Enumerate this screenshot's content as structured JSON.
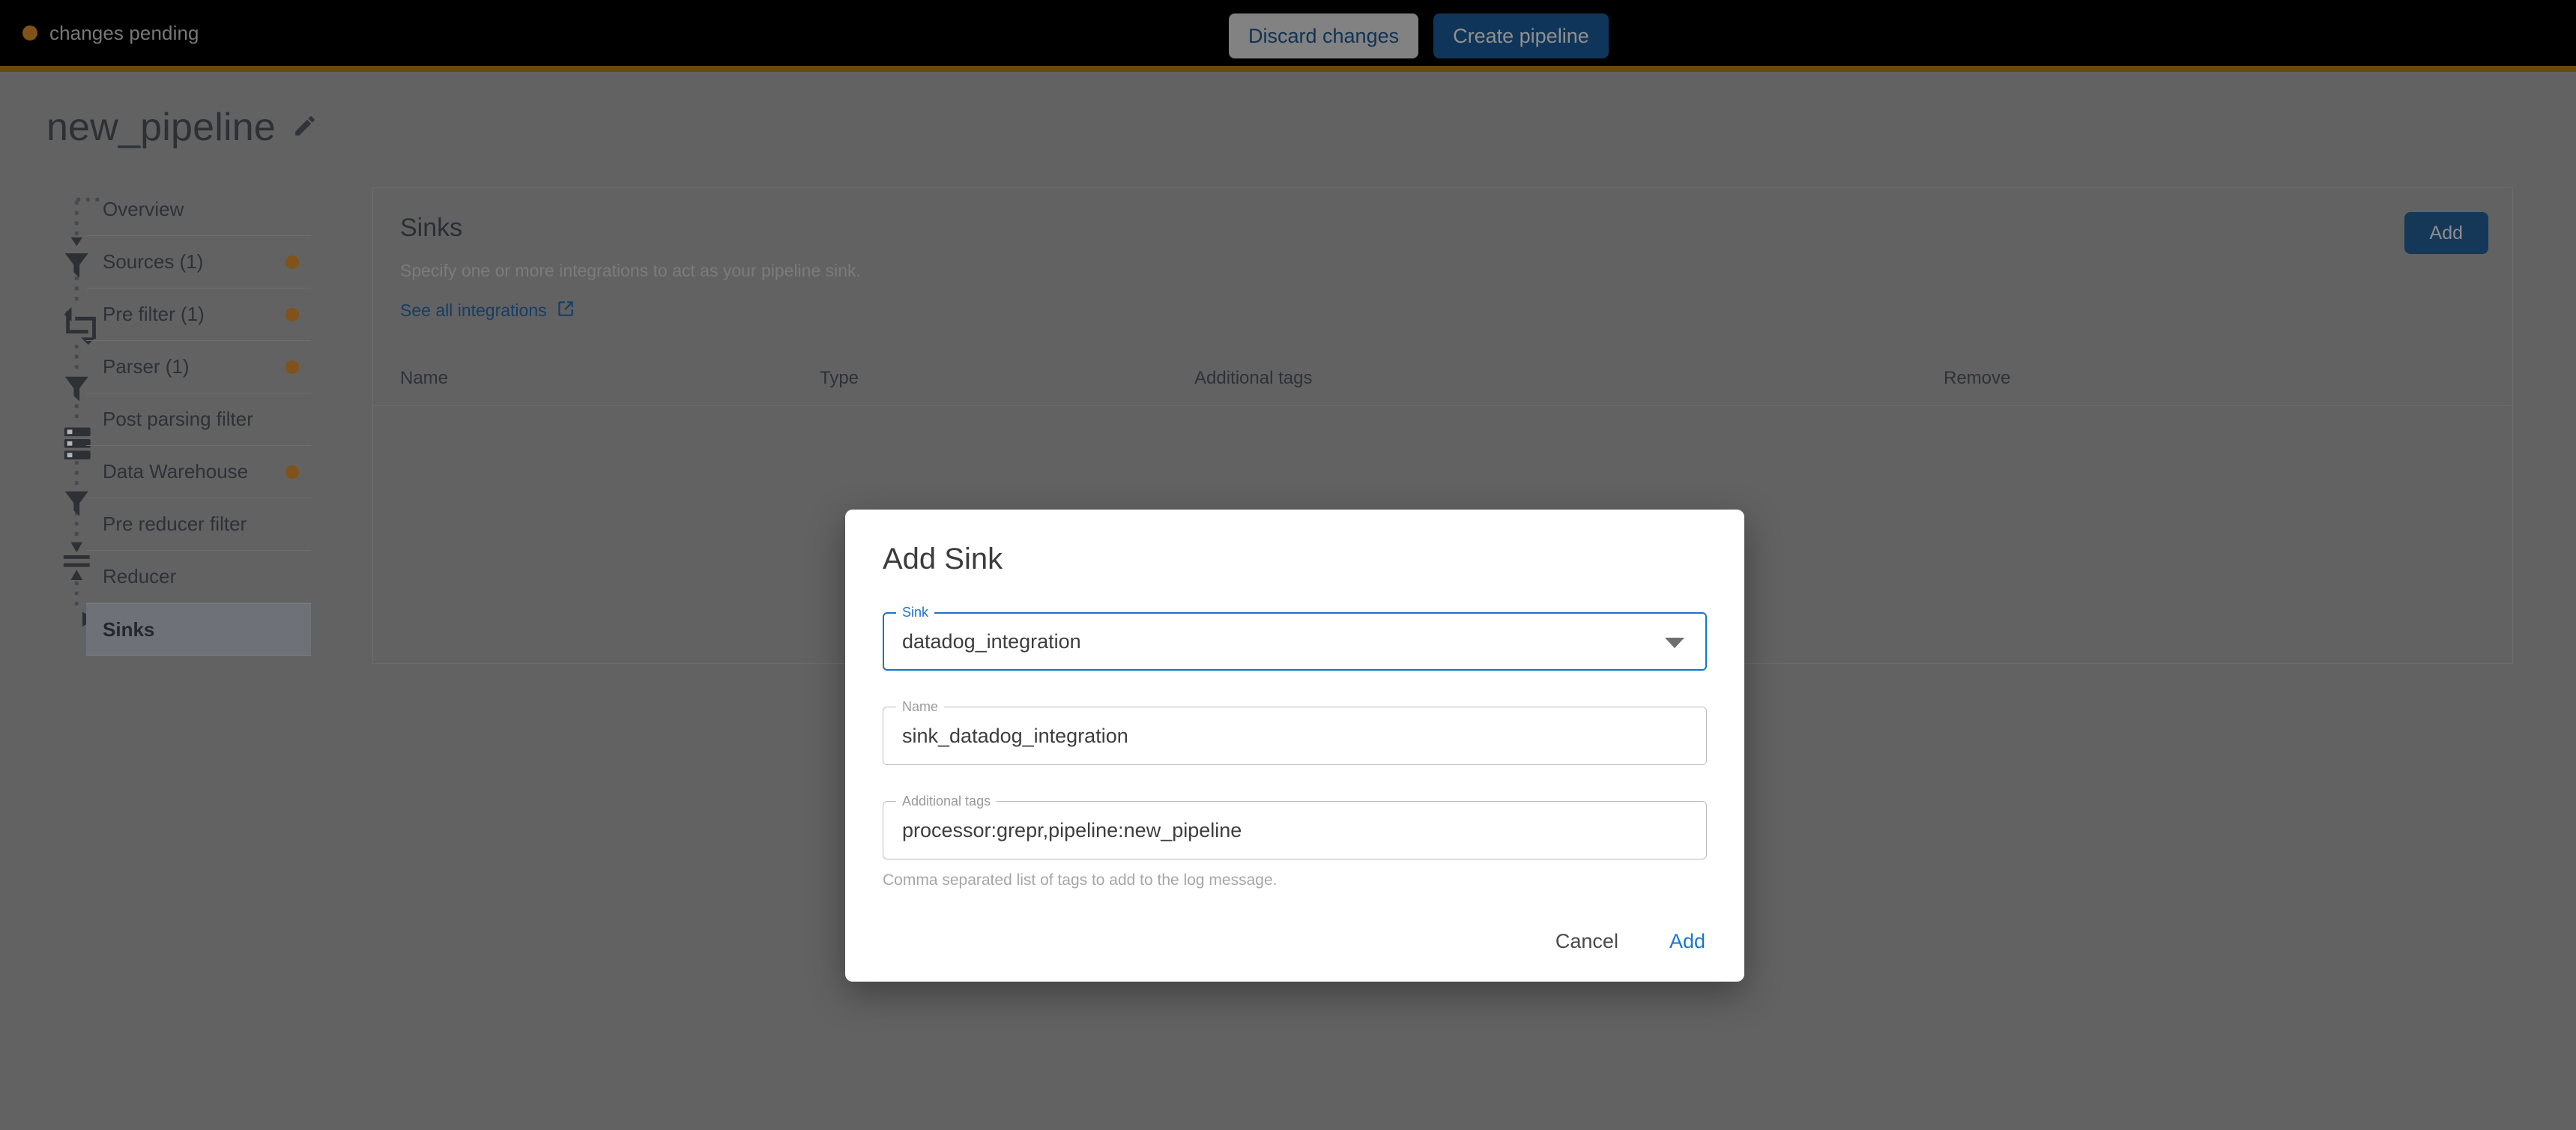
{
  "topbar": {
    "status_text": "changes pending",
    "status_dot_color": "#a66a20",
    "discard_label": "Discard changes",
    "create_label": "Create pipeline",
    "accent_border_color": "#8a5d16"
  },
  "header": {
    "pipeline_name": "new_pipeline",
    "edit_icon": "pencil-icon"
  },
  "sidebar": {
    "items": [
      {
        "label": "Overview",
        "icon": "",
        "dot": false,
        "selected": false
      },
      {
        "label": "Sources (1)",
        "icon": "flow-entry-icon",
        "dot": true,
        "selected": false
      },
      {
        "label": "Pre filter (1)",
        "icon": "filter-funnel-icon",
        "dot": true,
        "selected": false
      },
      {
        "label": "Parser (1)",
        "icon": "parser-crop-icon",
        "dot": true,
        "selected": false
      },
      {
        "label": "Post parsing filter",
        "icon": "filter-funnel-icon",
        "dot": false,
        "selected": false
      },
      {
        "label": "Data Warehouse",
        "icon": "database-icon",
        "dot": true,
        "selected": false
      },
      {
        "label": "Pre reducer filter",
        "icon": "filter-funnel-icon",
        "dot": false,
        "selected": false
      },
      {
        "label": "Reducer",
        "icon": "reducer-icon",
        "dot": false,
        "selected": false
      },
      {
        "label": "Sinks",
        "icon": "flow-exit-icon",
        "dot": false,
        "selected": true
      }
    ]
  },
  "main": {
    "title": "Sinks",
    "description": "Specify one or more integrations to act as your pipeline sink.",
    "link_label": "See all integrations",
    "link_icon": "external-link-icon",
    "add_button_label": "Add",
    "table": {
      "columns": [
        "Name",
        "Type",
        "Additional tags",
        "Remove"
      ],
      "rows": []
    }
  },
  "modal": {
    "title": "Add Sink",
    "fields": [
      {
        "label": "Sink",
        "value": "datadog_integration",
        "type": "select",
        "focused": true,
        "hint": ""
      },
      {
        "label": "Name",
        "value": "sink_datadog_integration",
        "type": "text",
        "focused": false,
        "hint": ""
      },
      {
        "label": "Additional tags",
        "value": "processor:grepr,pipeline:new_pipeline",
        "type": "text",
        "focused": false,
        "hint": "Comma separated list of tags to add to the log message."
      }
    ],
    "cancel_label": "Cancel",
    "submit_label": "Add",
    "accent_color": "#1877d2"
  }
}
